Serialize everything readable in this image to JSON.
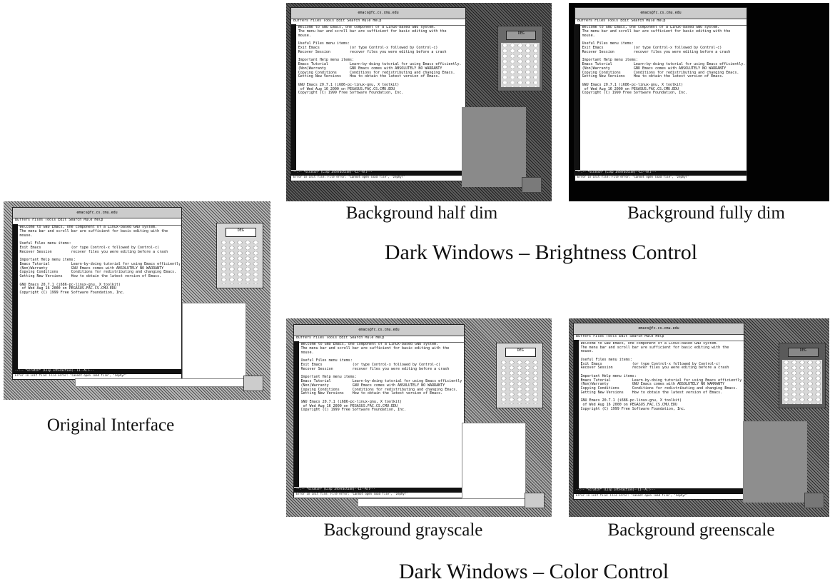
{
  "heading_brightness": "Dark Windows – Brightness Control",
  "heading_color": "Dark Windows – Color Control",
  "captions": {
    "original": "Original Interface",
    "half_dim": "Background half dim",
    "fully_dim": "Background fully dim",
    "grayscale": "Background grayscale",
    "greenscale": "Background greenscale"
  },
  "emacs": {
    "title": "emacs@fc.cs.cmu.edu",
    "menu": "Buffers Files Tools Edit Search Mule Help",
    "text": "Welcome to GNU Emacs, one component of a Linux-based GNU system.\nThe menu bar and scroll bar are sufficient for basic editing with the\nmouse.\n\nUseful Files menu items:\nExit Emacs              (or type Control-x followed by Control-c)\nRecover Session         recover files you were editing before a crash\n\nImportant Help menu items:\nEmacs Tutorial          Learn-by-doing tutorial for using Emacs efficiently.\n(Non)Warranty           GNU Emacs comes with ABSOLUTELY NO WARRANTY\nCopying Conditions      Conditions for redistributing and changing Emacs.\nGetting New Versions    How to obtain the latest version of Emacs.\n\nGNU Emacs 20.7.1 (i686-pc-linux-gnu, X toolkit)\n of Wed Aug 16 2000 on PEGASUS.FAC.CS.CMU.EDU\nCopyright (C) 1999 Free Software Foundation, Inc.",
    "modeline": "--:--  *scratch*        (Lisp Interaction)--L1--All---",
    "minibuffer": "Error in init file: File error: \"Cannot open load file\", \"zephyr\""
  },
  "calculator": {
    "display": "DEG"
  },
  "colors": {
    "background": "#ffffff",
    "text": "#111111"
  }
}
